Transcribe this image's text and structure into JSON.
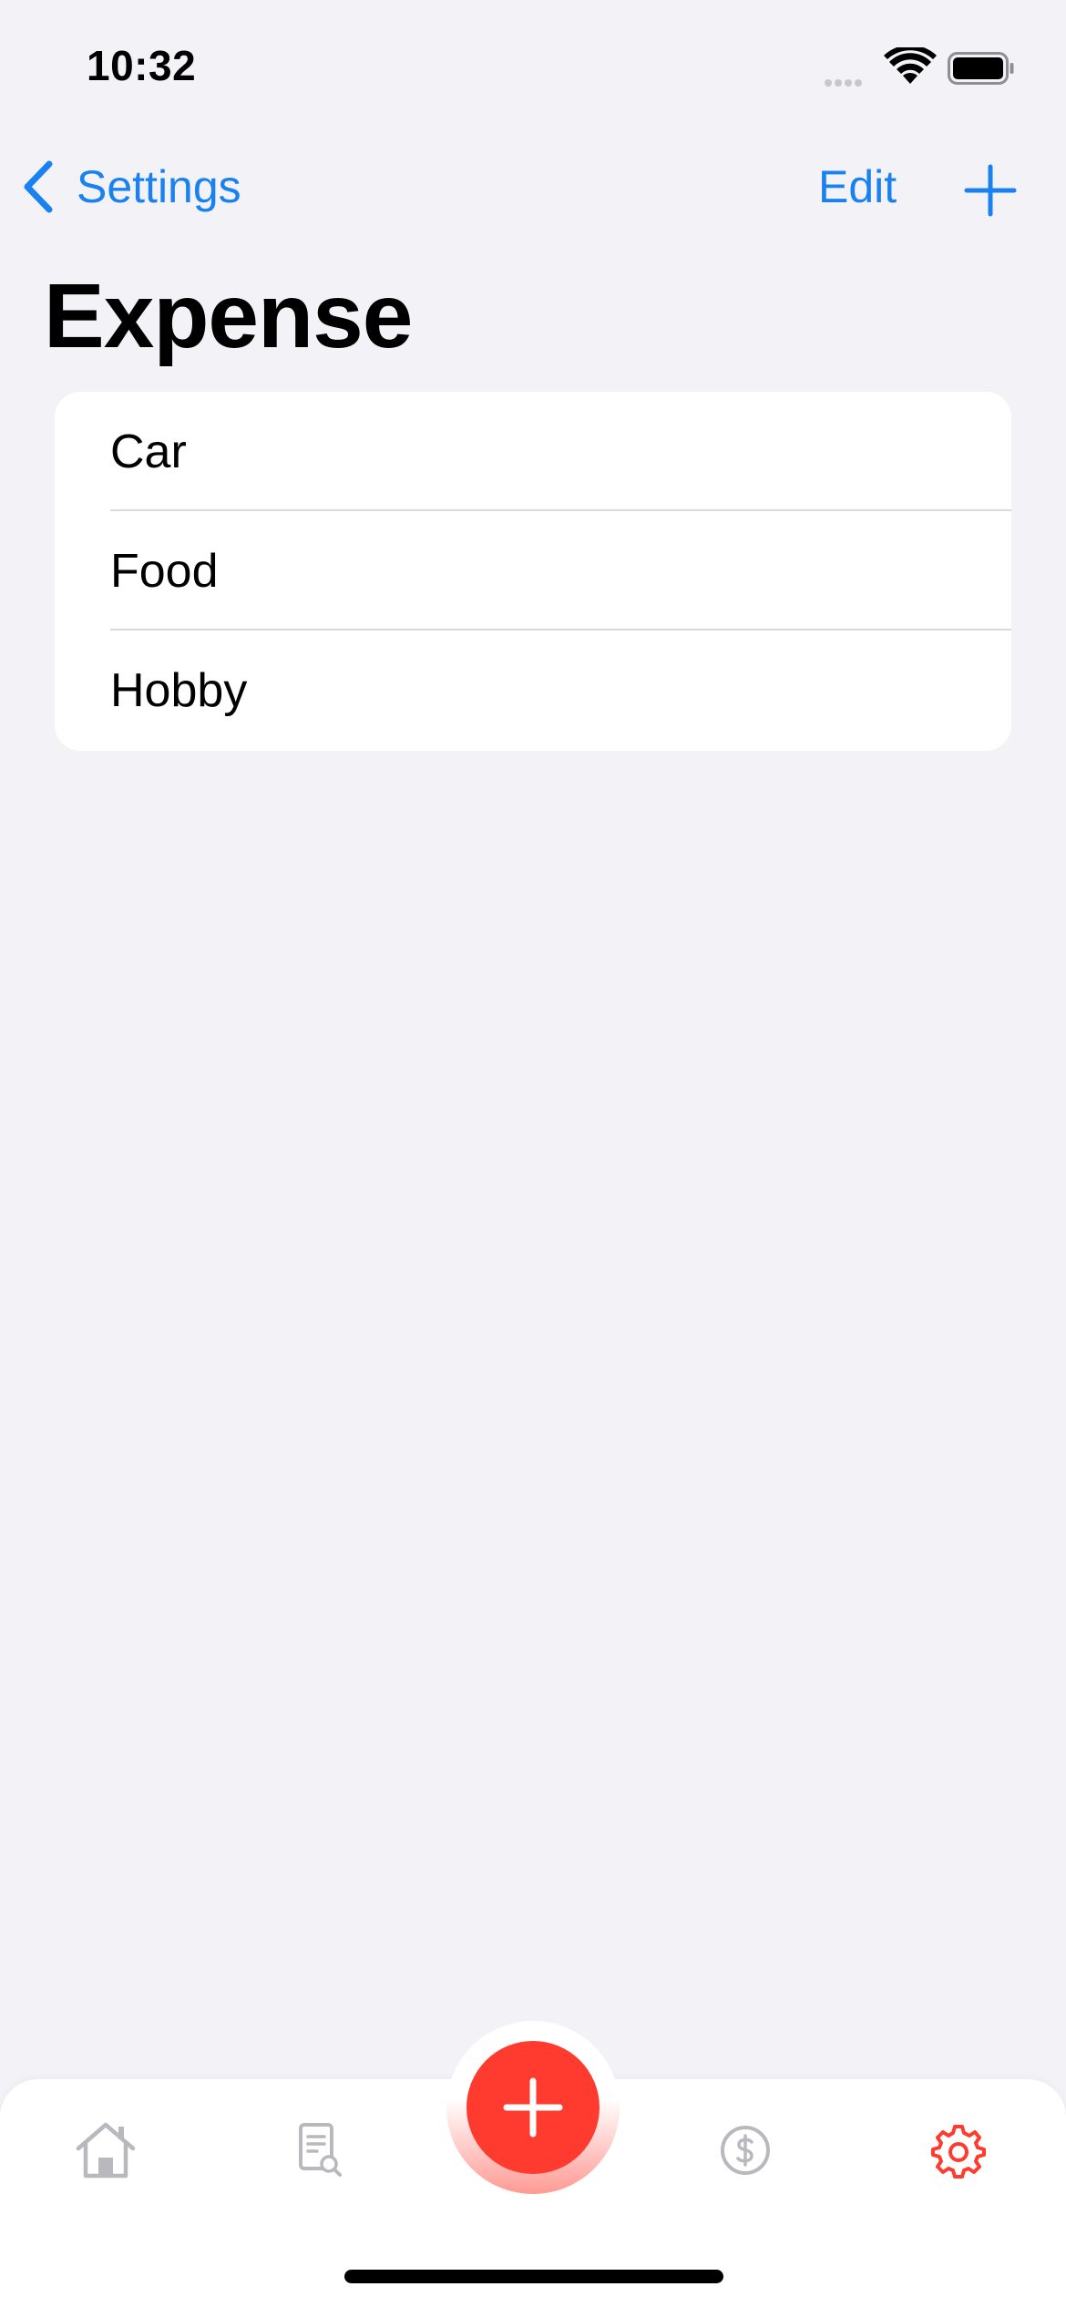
{
  "status_bar": {
    "time": "10:32"
  },
  "nav": {
    "back_label": "Settings",
    "edit_label": "Edit"
  },
  "page": {
    "title": "Expense"
  },
  "list": {
    "items": [
      {
        "label": "Car"
      },
      {
        "label": "Food"
      },
      {
        "label": "Hobby"
      }
    ]
  },
  "tab_bar": {
    "tabs": [
      {
        "icon": "home-icon"
      },
      {
        "icon": "report-search-icon"
      },
      {
        "icon": "add-icon"
      },
      {
        "icon": "dollar-icon"
      },
      {
        "icon": "gear-icon"
      }
    ],
    "active_tab": "settings"
  },
  "colors": {
    "accent": "#1a82f0",
    "fab": "#ff3b30",
    "active_tab": "#ff3b30",
    "inactive_tab": "#b8b8be",
    "background": "#f2f2f7"
  }
}
